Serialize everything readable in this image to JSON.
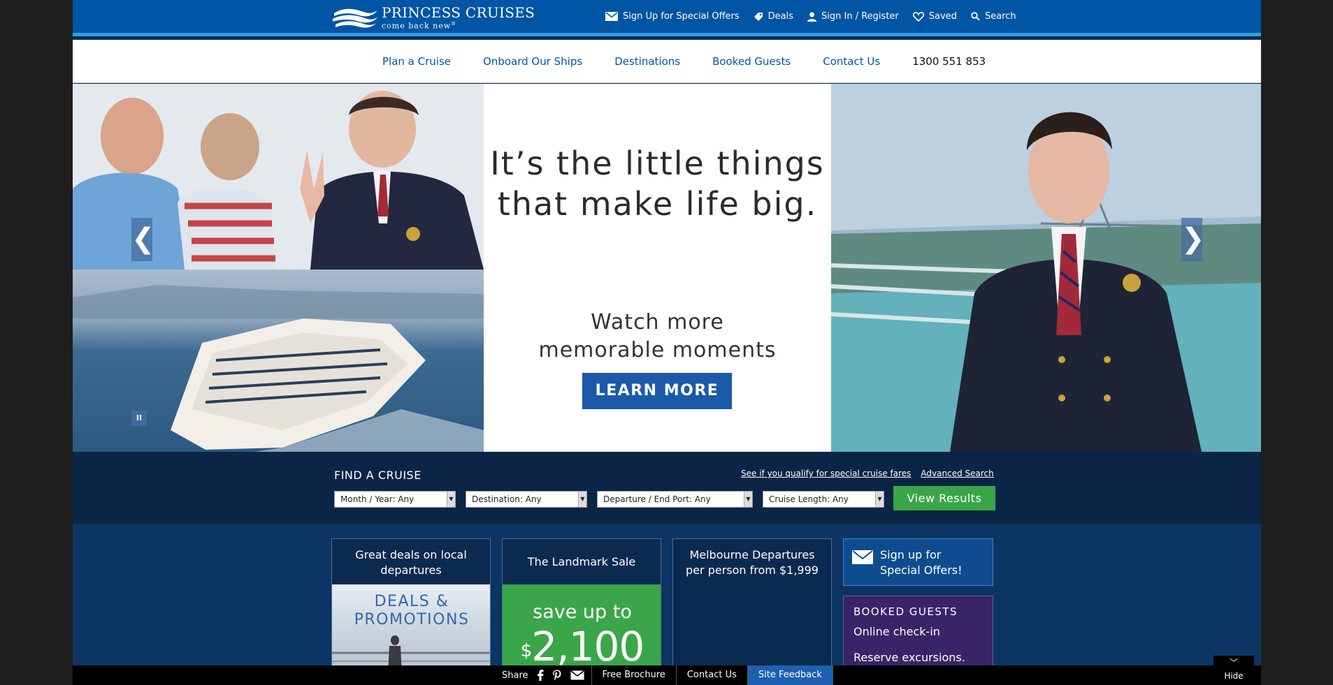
{
  "brand": {
    "name": "PRINCESS CRUISES",
    "tagline": "come back new",
    "trademark": "®"
  },
  "utility_nav": [
    {
      "label": "Sign Up for Special Offers",
      "icon": "envelope-icon"
    },
    {
      "label": "Deals",
      "icon": "tag-icon"
    },
    {
      "label": "Sign In / Register",
      "icon": "user-icon"
    },
    {
      "label": "Saved",
      "icon": "heart-icon"
    },
    {
      "label": "Search",
      "icon": "search-icon"
    }
  ],
  "main_nav": {
    "items": [
      "Plan a Cruise",
      "Onboard Our Ships",
      "Destinations",
      "Booked Guests",
      "Contact Us"
    ],
    "phone": "1300 551 853"
  },
  "hero": {
    "headline_line1": "It’s the little things",
    "headline_line2": "that make life big.",
    "sub_line1": "Watch more",
    "sub_line2": "memorable moments",
    "cta": "LEARN MORE",
    "prev_arrow": "❮",
    "next_arrow": "❯",
    "pause_glyph": "II"
  },
  "finder": {
    "title": "FIND A CRUISE",
    "link_fares": "See if you qualify for special cruise fares",
    "link_advanced": "Advanced Search",
    "selects": [
      {
        "name": "month-year-select",
        "value": "Month / Year: Any"
      },
      {
        "name": "destination-select",
        "value": "Destination: Any"
      },
      {
        "name": "departure-port-select",
        "value": "Departure / End Port: Any"
      },
      {
        "name": "cruise-length-select",
        "value": "Cruise Length: Any"
      }
    ],
    "button": "View Results"
  },
  "promos": {
    "local": {
      "title": "Great deals on local departures",
      "image_text_line1": "DEALS &",
      "image_text_line2": "PROMOTIONS"
    },
    "landmark": {
      "title": "The Landmark Sale",
      "save_text": "save up to",
      "currency": "$",
      "amount": "2,100"
    },
    "melbourne": {
      "title_line1": "Melbourne Departures",
      "title_line2": "per person from $1,999"
    },
    "signup": {
      "line1": "Sign up for",
      "line2": "Special Offers!"
    },
    "booked": {
      "title": "BOOKED GUESTS",
      "link1": "Online check-in",
      "link2": "Reserve excursions."
    }
  },
  "bottom_bar": {
    "share": "Share",
    "brochure": "Free Brochure",
    "contact": "Contact Us",
    "feedback": "Site Feedback",
    "hide": "Hide"
  },
  "colors": {
    "brand_blue": "#0055a5",
    "accent_cyan": "#2d9fdd",
    "finder_bg": "#0b2546",
    "promo_bg": "#0d3563",
    "green": "#3aa649",
    "purple": "#3a2467"
  }
}
